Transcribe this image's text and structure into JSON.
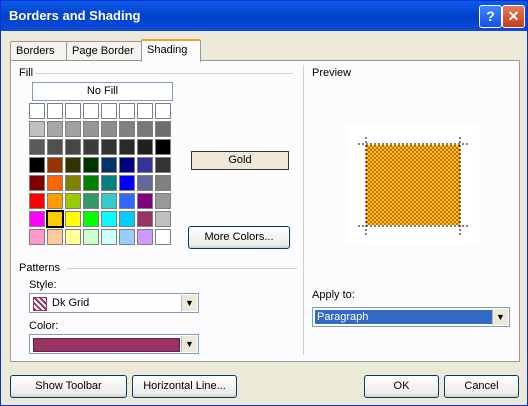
{
  "window": {
    "title": "Borders and Shading",
    "help_glyph": "?",
    "close_glyph": "✕"
  },
  "tabs": [
    {
      "label": "Borders"
    },
    {
      "label": "Page Border"
    },
    {
      "label": "Shading",
      "active": true
    }
  ],
  "fill": {
    "label": "Fill",
    "no_fill": "No Fill",
    "selected_color_name": "Gold",
    "more_colors": "More Colors...",
    "palette": [
      [
        "#ffffff",
        "#ffffff",
        "#ffffff",
        "#ffffff",
        "#ffffff",
        "#ffffff",
        "#ffffff",
        "#ffffff"
      ],
      [
        "#c0c0c0",
        "#a6a6a6",
        "#a0a0a0",
        "#969696",
        "#8c8c8c",
        "#808080",
        "#787878",
        "#6e6e6e"
      ],
      [
        "#5a5a5a",
        "#505050",
        "#464646",
        "#3c3c3c",
        "#333333",
        "#2a2a2a",
        "#202020",
        "#000000"
      ],
      [
        "#000000",
        "#993300",
        "#333300",
        "#003300",
        "#003366",
        "#000080",
        "#333399",
        "#333333"
      ],
      [
        "#800000",
        "#ff6600",
        "#808000",
        "#008000",
        "#008080",
        "#0000ff",
        "#666699",
        "#808080"
      ],
      [
        "#ff0000",
        "#ff9900",
        "#99cc00",
        "#339966",
        "#33cccc",
        "#3366ff",
        "#800080",
        "#999999"
      ],
      [
        "#ff00ff",
        "#ffcc00",
        "#ffff00",
        "#00ff00",
        "#00ffff",
        "#00ccff",
        "#993366",
        "#c0c0c0"
      ],
      [
        "#ff99cc",
        "#ffcc99",
        "#ffff99",
        "#ccffcc",
        "#ccffff",
        "#99ccff",
        "#cc99ff",
        "#ffffff"
      ]
    ],
    "selected": {
      "row": 6,
      "col": 1
    }
  },
  "patterns": {
    "label": "Patterns",
    "style_label": "Style:",
    "style_value": "Dk Grid",
    "color_label": "Color:",
    "color_value_hex": "#993366"
  },
  "preview": {
    "label": "Preview",
    "fill_color": "#ffcc00",
    "pattern_color": "#c86414"
  },
  "apply_to": {
    "label": "Apply to:",
    "value": "Paragraph"
  },
  "buttons": {
    "show_toolbar": "Show Toolbar",
    "horizontal_line": "Horizontal Line...",
    "ok": "OK",
    "cancel": "Cancel"
  }
}
